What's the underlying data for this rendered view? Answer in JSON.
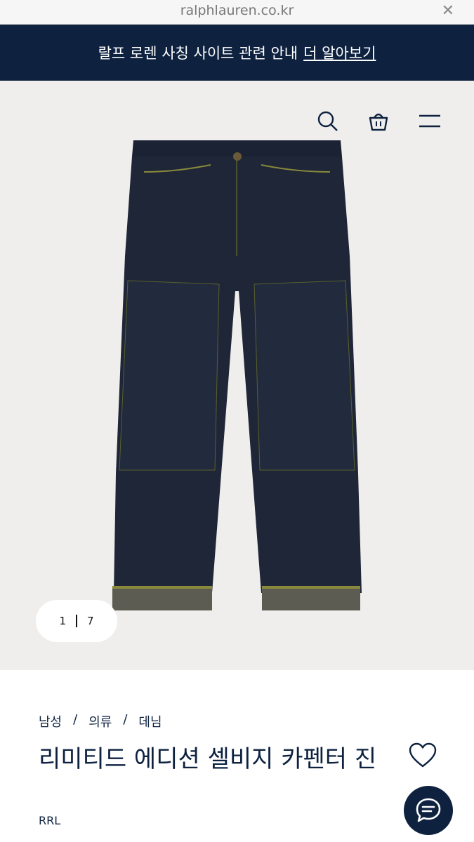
{
  "browser": {
    "url": "ralphlauren.co.kr"
  },
  "banner": {
    "text": "랄프 로렌 사칭 사이트 관련 안내",
    "link_label": "더 알아보기"
  },
  "header": {
    "icons": [
      "search-icon",
      "bag-icon",
      "menu-icon"
    ]
  },
  "gallery": {
    "current": "1",
    "total": "7"
  },
  "breadcrumb": {
    "items": [
      "남성",
      "의류",
      "데님"
    ],
    "separator": "/"
  },
  "product": {
    "title": "리미티드 에디션 셀비지 카펜터 진",
    "brand": "RRL"
  },
  "colors": {
    "navy": "#0e2240",
    "hero_bg": "#efeeec"
  }
}
